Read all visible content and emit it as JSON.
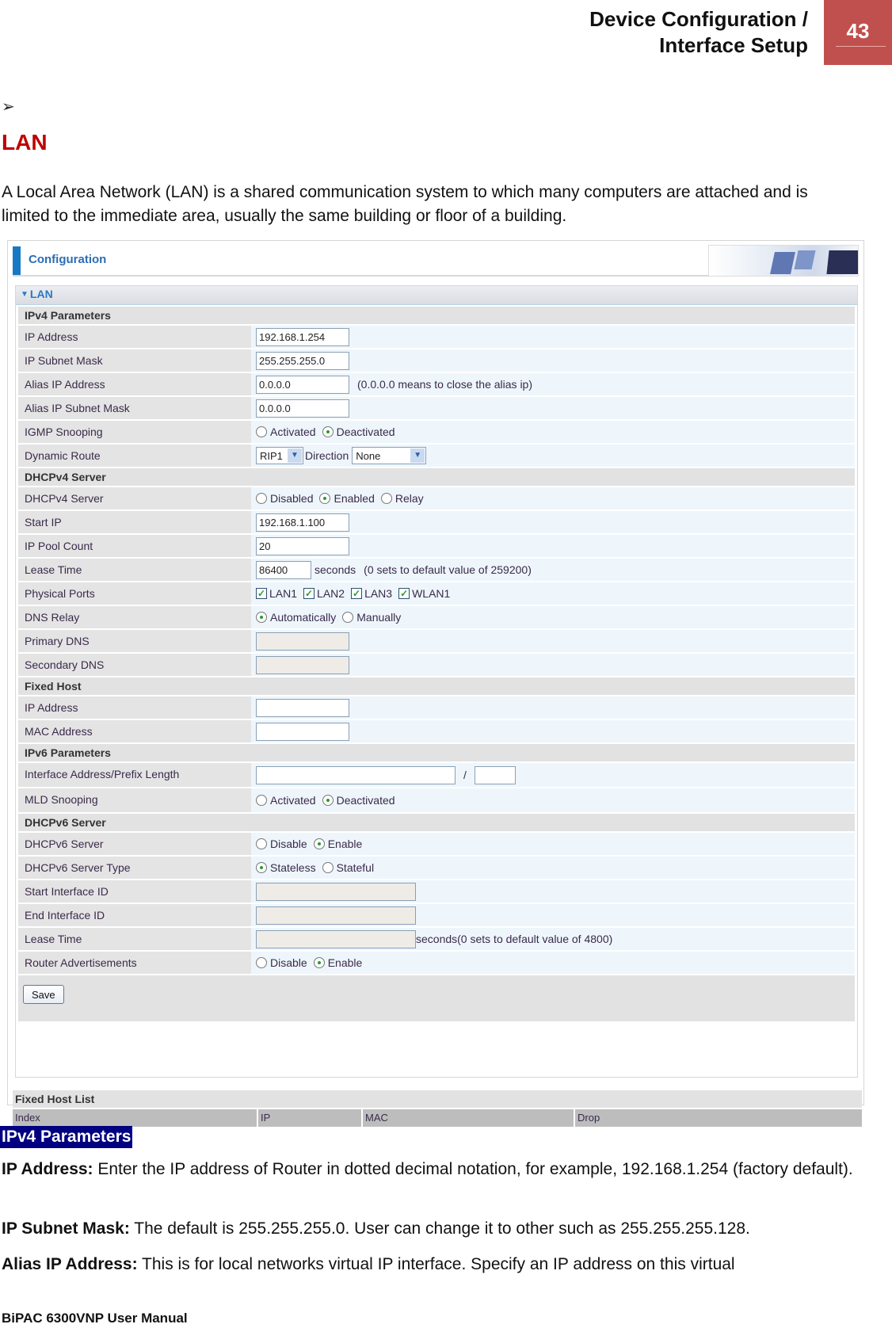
{
  "header": {
    "title_line1": "Device Configuration /",
    "title_line2": "Interface Setup",
    "page_number": "43"
  },
  "section": {
    "bullet": "➢",
    "title": "LAN",
    "intro": "A Local Area Network (LAN) is a shared communication system to which many computers are attached and is limited to the immediate area, usually the same building or floor of a building."
  },
  "screenshot": {
    "config_title": "Configuration",
    "panel_title": "LAN",
    "ipv4": {
      "heading": "IPv4 Parameters",
      "ip_address": {
        "label": "IP Address",
        "value": "192.168.1.254"
      },
      "subnet_mask": {
        "label": "IP Subnet Mask",
        "value": "255.255.255.0"
      },
      "alias_ip": {
        "label": "Alias IP Address",
        "value": "0.0.0.0",
        "note": "(0.0.0.0 means to close the alias ip)"
      },
      "alias_mask": {
        "label": "Alias IP Subnet Mask",
        "value": "0.0.0.0"
      },
      "igmp": {
        "label": "IGMP Snooping",
        "options": [
          "Activated",
          "Deactivated"
        ],
        "selected": "Deactivated"
      },
      "dynamic_route": {
        "label": "Dynamic Route",
        "route_value": "RIP1",
        "direction_label": "Direction",
        "direction_value": "None"
      }
    },
    "dhcpv4": {
      "heading": "DHCPv4 Server",
      "server": {
        "label": "DHCPv4 Server",
        "options": [
          "Disabled",
          "Enabled",
          "Relay"
        ],
        "selected": "Enabled"
      },
      "start_ip": {
        "label": "Start IP",
        "value": "192.168.1.100"
      },
      "pool_count": {
        "label": "IP Pool Count",
        "value": "20"
      },
      "lease_time": {
        "label": "Lease Time",
        "value": "86400",
        "unit": "seconds",
        "note": "(0 sets to default value of 259200)"
      },
      "physical_ports": {
        "label": "Physical Ports",
        "ports": [
          "LAN1",
          "LAN2",
          "LAN3",
          "WLAN1"
        ],
        "checked": [
          true,
          true,
          true,
          true
        ]
      },
      "dns_relay": {
        "label": "DNS Relay",
        "options": [
          "Automatically",
          "Manually"
        ],
        "selected": "Automatically"
      },
      "primary_dns": {
        "label": "Primary DNS",
        "value": ""
      },
      "secondary_dns": {
        "label": "Secondary DNS",
        "value": ""
      }
    },
    "fixed_host": {
      "heading": "Fixed Host",
      "ip_address": {
        "label": "IP Address",
        "value": ""
      },
      "mac_address": {
        "label": "MAC Address",
        "value": ""
      }
    },
    "ipv6": {
      "heading": "IPv6 Parameters",
      "interface_address": {
        "label": "Interface Address/Prefix Length",
        "value": "",
        "separator": "/",
        "prefix": ""
      },
      "mld": {
        "label": "MLD Snooping",
        "options": [
          "Activated",
          "Deactivated"
        ],
        "selected": "Deactivated"
      }
    },
    "dhcpv6": {
      "heading": "DHCPv6 Server",
      "server": {
        "label": "DHCPv6 Server",
        "options": [
          "Disable",
          "Enable"
        ],
        "selected": "Enable"
      },
      "server_type": {
        "label": "DHCPv6 Server Type",
        "options": [
          "Stateless",
          "Stateful"
        ],
        "selected": "Stateless"
      },
      "start_id": {
        "label": "Start Interface ID",
        "value": ""
      },
      "end_id": {
        "label": "End Interface ID",
        "value": ""
      },
      "lease_time": {
        "label": "Lease Time",
        "value": "",
        "note": "seconds(0 sets to default value of 4800)"
      },
      "router_adv": {
        "label": "Router Advertisements",
        "options": [
          "Disable",
          "Enable"
        ],
        "selected": "Enable"
      }
    },
    "save_label": "Save",
    "fixed_host_list": {
      "title": "Fixed Host List",
      "columns": [
        "Index",
        "IP",
        "MAC",
        "Drop"
      ]
    }
  },
  "body": {
    "highlight": "IPv4 Parameters",
    "paragraphs": [
      {
        "term": "IP Address:",
        "text": " Enter the IP address of Router in dotted decimal notation, for example, 192.168.1.254 (factory default)."
      },
      {
        "term": "IP Subnet Mask:",
        "text": " The default is 255.255.255.0. User can change it to other such as 255.255.255.128."
      },
      {
        "term": "Alias IP Address:",
        "text": " This is for local networks virtual IP interface. Specify an IP address on this virtual"
      }
    ]
  },
  "footer": "BiPAC 6300VNP User Manual"
}
